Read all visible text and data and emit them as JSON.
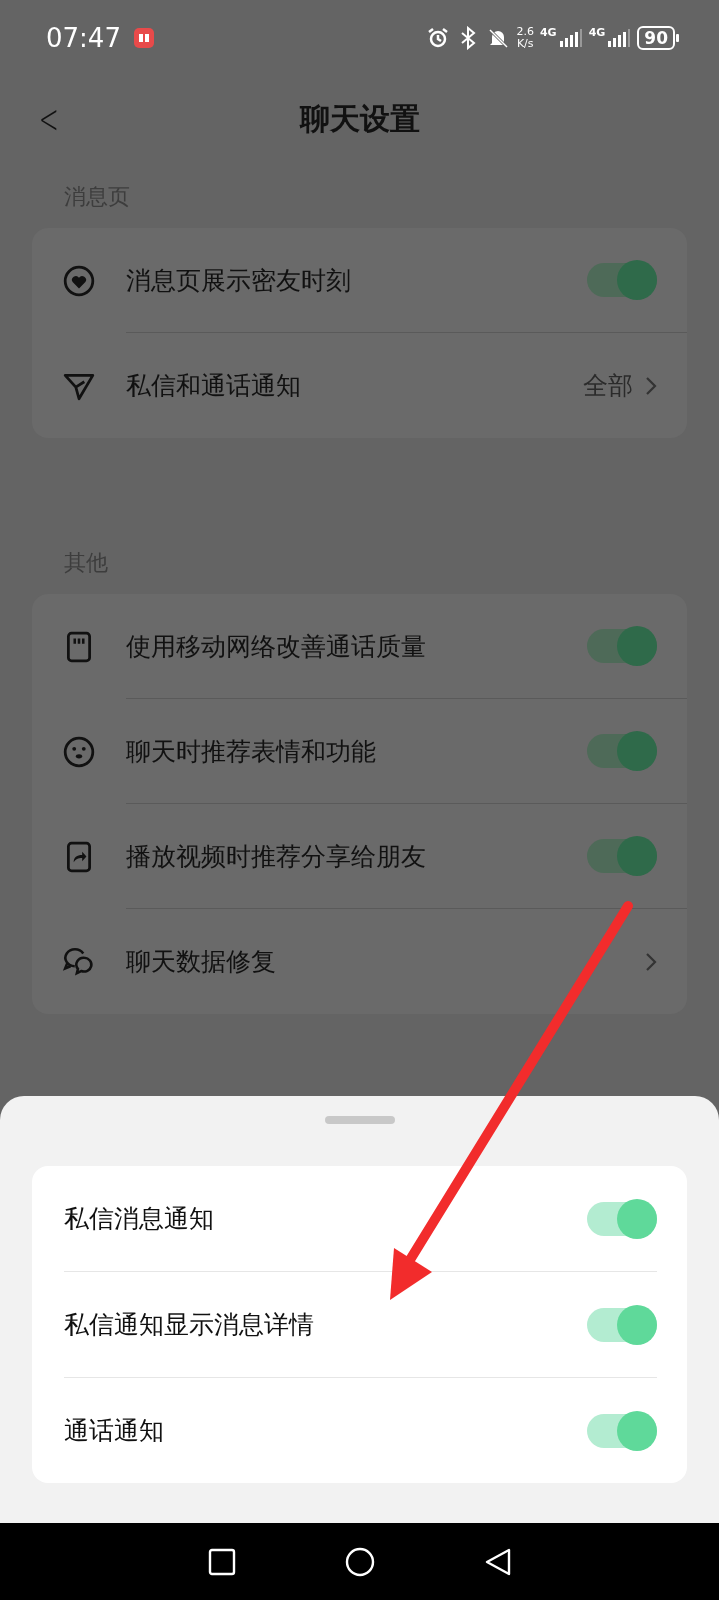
{
  "status_bar": {
    "time": "07:47",
    "speed_value": "2.6",
    "speed_unit": "K/s",
    "network_1": "4G",
    "network_2": "4G",
    "battery": "90"
  },
  "header": {
    "back": "<",
    "title": "聊天设置"
  },
  "sections": [
    {
      "title": "消息页",
      "items": [
        {
          "kind": "toggle",
          "label": "消息页展示密友时刻",
          "on": true
        },
        {
          "kind": "link",
          "label": "私信和通话通知",
          "value": "全部"
        }
      ]
    },
    {
      "title": "其他",
      "items": [
        {
          "kind": "toggle",
          "label": "使用移动网络改善通话质量",
          "on": true
        },
        {
          "kind": "toggle",
          "label": "聊天时推荐表情和功能",
          "on": true
        },
        {
          "kind": "toggle",
          "label": "播放视频时推荐分享给朋友",
          "on": true
        },
        {
          "kind": "link",
          "label": "聊天数据修复"
        }
      ]
    }
  ],
  "sheet": {
    "items": [
      {
        "label": "私信消息通知",
        "on": true
      },
      {
        "label": "私信通知显示消息详情",
        "on": true
      },
      {
        "label": "通话通知",
        "on": true
      }
    ]
  }
}
